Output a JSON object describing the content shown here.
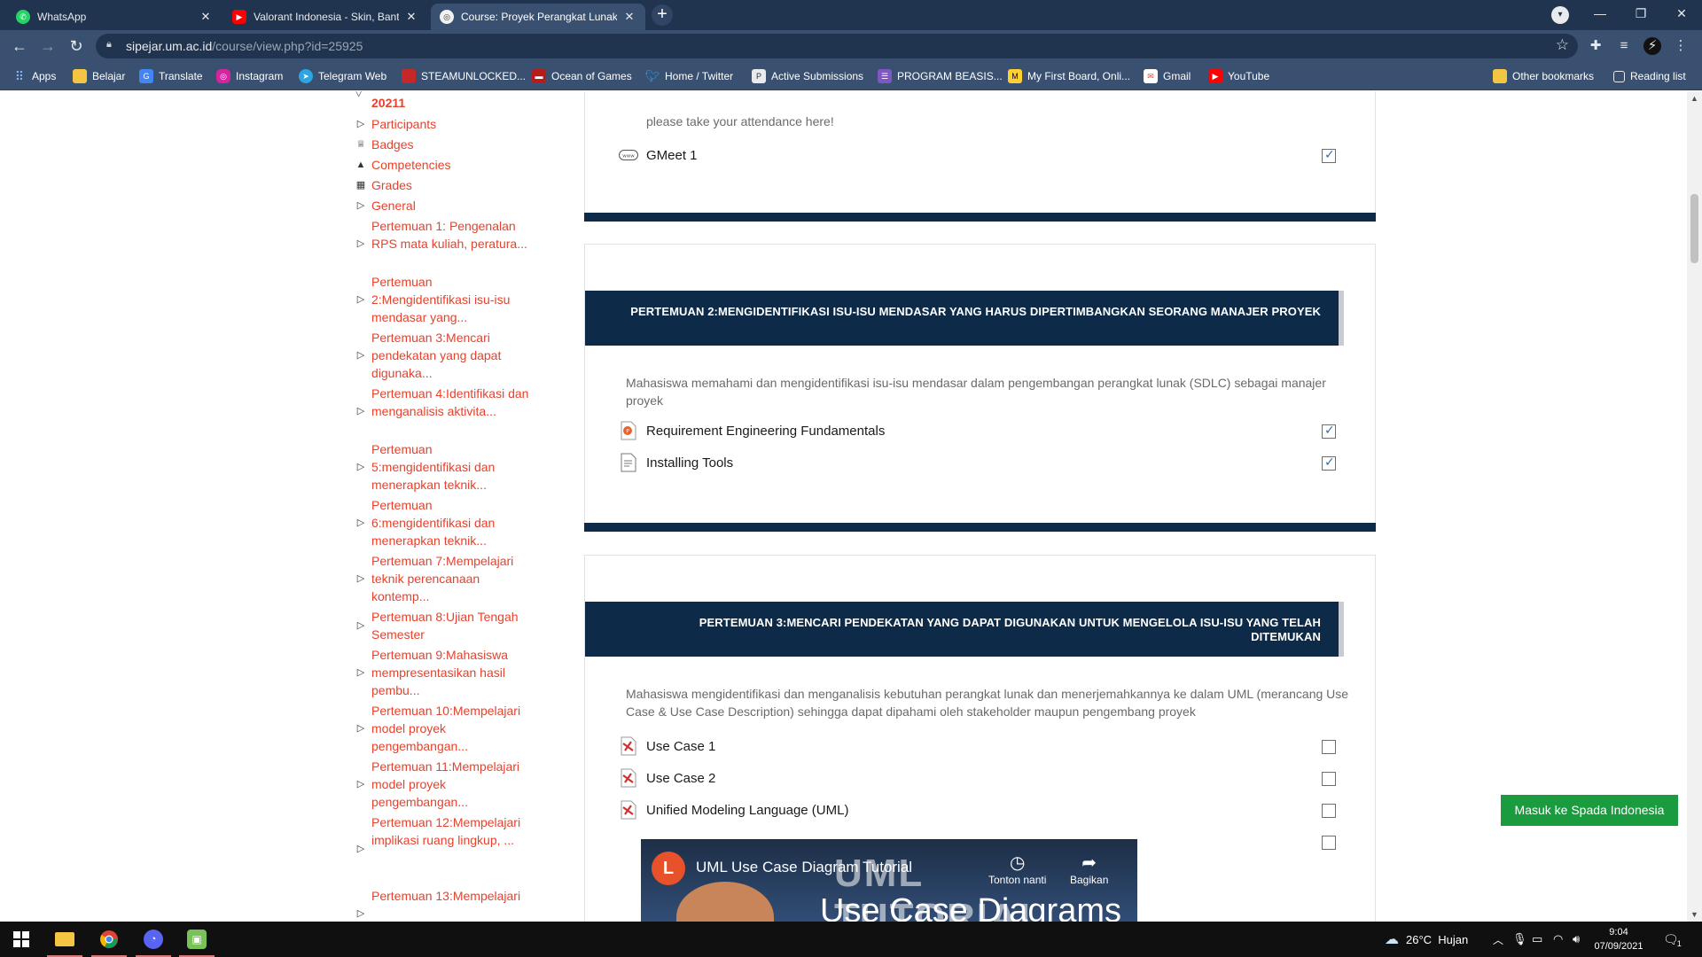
{
  "browser": {
    "tabs": [
      {
        "title": "WhatsApp",
        "icon": "whatsapp-icon",
        "color": "#25d366"
      },
      {
        "title": "Valorant Indonesia - Skin, Banting",
        "icon": "youtube-icon",
        "color": "#ff0000"
      },
      {
        "title": "Course: Proyek Perangkat Lunak",
        "icon": "moodle-icon",
        "color": "#f2f2f2"
      }
    ],
    "url_host": "sipejar.um.ac.id",
    "url_path": "/course/view.php?id=25925",
    "bookmarks": [
      {
        "label": "Apps",
        "icon": "apps-grid-icon",
        "color": "#4285f4"
      },
      {
        "label": "Belajar",
        "icon": "folder-icon",
        "color": "#f4c542"
      },
      {
        "label": "Translate",
        "icon": "translate-icon",
        "color": "#4285f4"
      },
      {
        "label": "Instagram",
        "icon": "instagram-icon",
        "color": "#d6249f"
      },
      {
        "label": "Telegram Web",
        "icon": "telegram-icon",
        "color": "#2ca5e0"
      },
      {
        "label": "STEAMUNLOCKED...",
        "icon": "steamunlocked-icon",
        "color": "#c62828"
      },
      {
        "label": "Ocean of Games",
        "icon": "ocean-of-games-icon",
        "color": "#b71c1c"
      },
      {
        "label": "Home / Twitter",
        "icon": "twitter-icon",
        "color": "#1da1f2"
      },
      {
        "label": "Active Submissions",
        "icon": "submissions-icon",
        "color": "#e8eaed"
      },
      {
        "label": "PROGRAM BEASIS...",
        "icon": "form-icon",
        "color": "#7e57c2"
      },
      {
        "label": "My First Board, Onli...",
        "icon": "miro-icon",
        "color": "#ffd02f"
      },
      {
        "label": "Gmail",
        "icon": "gmail-icon",
        "color": "#ea4335"
      },
      {
        "label": "YouTube",
        "icon": "youtube-icon",
        "color": "#ff0000"
      }
    ],
    "other_bookmarks": "Other bookmarks",
    "reading_list": "Reading list"
  },
  "nav": {
    "course_code": "20211",
    "items": [
      {
        "label": "Participants",
        "icon": "expand-arrow-icon"
      },
      {
        "label": "Badges",
        "icon": "badge-icon"
      },
      {
        "label": "Competencies",
        "icon": "competencies-icon"
      },
      {
        "label": "Grades",
        "icon": "grades-table-icon"
      },
      {
        "label": "General",
        "icon": "expand-arrow-icon"
      },
      {
        "label": "Pertemuan 1: Pengenalan RPS mata kuliah, peratura...",
        "icon": "expand-arrow-icon"
      },
      {
        "label": "Pertemuan 2:Mengidentifikasi isu-isu mendasar yang...",
        "icon": "expand-arrow-icon"
      },
      {
        "label": "Pertemuan 3:Mencari pendekatan yang dapat digunaka...",
        "icon": "expand-arrow-icon"
      },
      {
        "label": "Pertemuan 4:Identifikasi dan menganalisis aktivita...",
        "icon": "expand-arrow-icon"
      },
      {
        "label": "Pertemuan 5:mengidentifikasi dan menerapkan teknik...",
        "icon": "expand-arrow-icon"
      },
      {
        "label": "Pertemuan 6:mengidentifikasi dan menerapkan teknik...",
        "icon": "expand-arrow-icon"
      },
      {
        "label": "Pertemuan 7:Mempelajari teknik perencanaan kontemp...",
        "icon": "expand-arrow-icon"
      },
      {
        "label": "Pertemuan 8:Ujian Tengah Semester",
        "icon": "expand-arrow-icon"
      },
      {
        "label": "Pertemuan 9:Mahasiswa mempresentasikan hasil pembu...",
        "icon": "expand-arrow-icon"
      },
      {
        "label": "Pertemuan 10:Mempelajari model proyek pengembangan...",
        "icon": "expand-arrow-icon"
      },
      {
        "label": "Pertemuan 11:Mempelajari model proyek pengembangan...",
        "icon": "expand-arrow-icon"
      },
      {
        "label": "Pertemuan 12:Mempelajari implikasi ruang lingkup, ...",
        "icon": "expand-arrow-icon"
      },
      {
        "label": "Pertemuan 13:Mempelajari",
        "icon": "expand-arrow-icon"
      }
    ]
  },
  "section1": {
    "description": "please take your attendance here!",
    "activities": [
      {
        "label": "GMeet 1",
        "icon": "url-link-icon",
        "completed": true
      }
    ]
  },
  "section2": {
    "title": "PERTEMUAN 2:MENGIDENTIFIKASI ISU-ISU MENDASAR YANG HARUS DIPERTIMBANGKAN SEORANG MANAJER PROYEK",
    "description": "Mahasiswa memahami dan mengidentifikasi isu-isu mendasar dalam pengembangan perangkat lunak (SDLC) sebagai manajer proyek",
    "activities": [
      {
        "label": "Requirement Engineering Fundamentals",
        "icon": "powerpoint-file-icon",
        "completed": true
      },
      {
        "label": "Installing Tools",
        "icon": "document-file-icon",
        "completed": true
      }
    ]
  },
  "section3": {
    "title": "PERTEMUAN 3:MENCARI PENDEKATAN YANG DAPAT DIGUNAKAN UNTUK MENGELOLA ISU-ISU YANG TELAH DITEMUKAN",
    "description": "Mahasiswa mengidentifikasi dan menganalisis kebutuhan perangkat lunak dan menerjemahkannya ke dalam UML (merancang Use Case & Use Case Description) sehingga dapat dipahami oleh stakeholder maupun pengembang proyek",
    "activities": [
      {
        "label": "Use Case 1",
        "icon": "pdf-file-icon",
        "completed": false
      },
      {
        "label": "Use Case 2",
        "icon": "pdf-file-icon",
        "completed": false
      },
      {
        "label": "Unified Modeling Language (UML)",
        "icon": "pdf-file-icon",
        "completed": false
      }
    ],
    "video": {
      "title": "UML Use Case Diagram Tutorial",
      "banner_line1": "UML TUTORIAL",
      "banner_line2": "Use Case Diagrams",
      "watch_later": "Tonton nanti",
      "share": "Bagikan",
      "completed": false
    }
  },
  "spada_button": "Masuk ke Spada Indonesia",
  "taskbar": {
    "weather": "26°C  Hujan",
    "time": "9:04",
    "date": "07/09/2021",
    "notification_count": "1"
  }
}
